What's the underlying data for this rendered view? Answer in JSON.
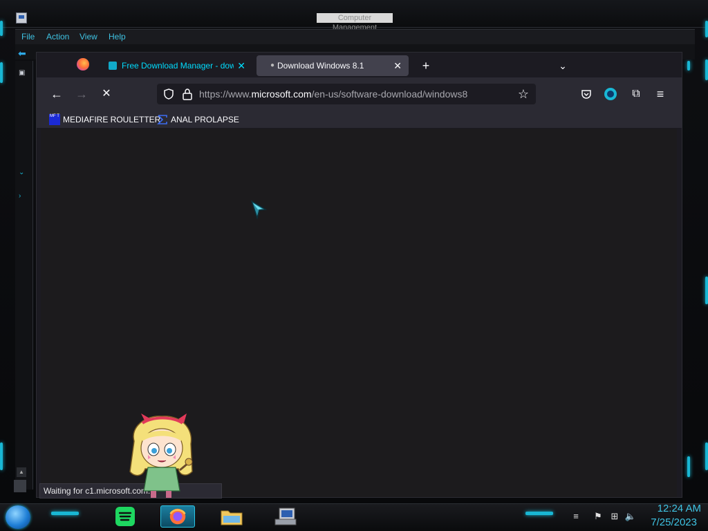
{
  "outer_window": {
    "title": "Computer Management",
    "menu": [
      "File",
      "Action",
      "View",
      "Help"
    ]
  },
  "browser": {
    "tabs": [
      {
        "label": "Free Download Manager - dow",
        "active": false,
        "close": "✕"
      },
      {
        "label": "Download Windows 8.1",
        "active": true,
        "close": "✕"
      }
    ],
    "new_tab": "+",
    "tab_list": "⌄",
    "url": {
      "prefix": "https://www.",
      "domain": "microsoft.com",
      "path": "/en-us/software-download/windows8"
    },
    "nav": {
      "back": "←",
      "forward": "→",
      "stop": "✕"
    },
    "bookmarks": [
      {
        "label": "MEDIAFIRE ROULETTER",
        "icon_text": "MF T"
      },
      {
        "label": "ANAL PROLAPSE"
      }
    ],
    "status_text": "Waiting for c1.microsoft.com..."
  },
  "taskbar": {
    "clock_time": "12:24 AM",
    "clock_date": "7/25/2023"
  },
  "colors": {
    "accent_cyan": "#19b7d4",
    "menu_text": "#3fc3e3",
    "tab_inactive_text": "#00ddff"
  },
  "icons": [
    "start-orb-icon",
    "spotify-icon",
    "firefox-icon",
    "file-explorer-icon",
    "computer-management-icon",
    "flag-icon",
    "network-icon",
    "volume-icon",
    "shield-icon",
    "lock-icon",
    "star-icon",
    "pocket-icon",
    "account-icon",
    "extensions-icon",
    "menu-icon"
  ]
}
